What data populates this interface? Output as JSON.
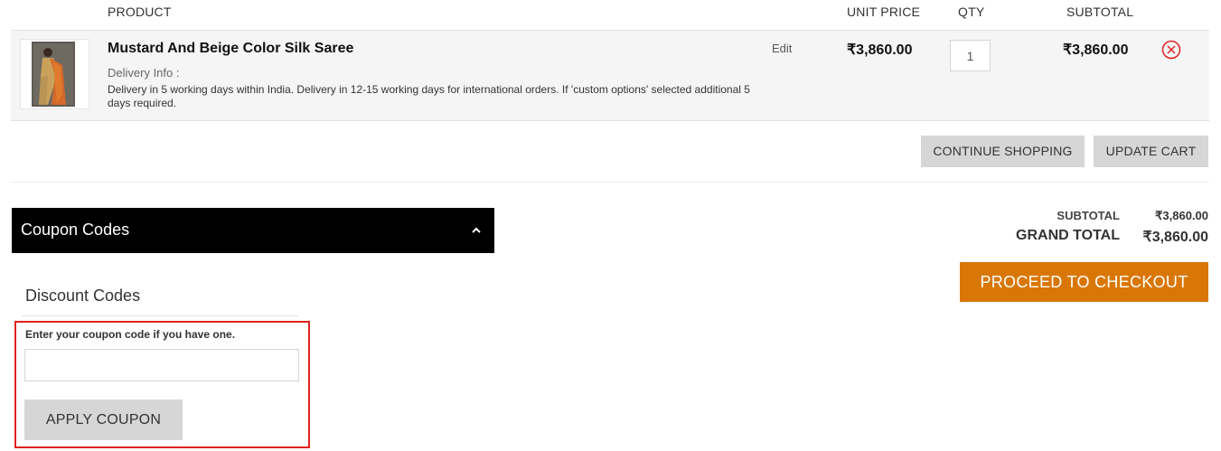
{
  "table_header": {
    "product": "PRODUCT",
    "unit_price": "UNIT PRICE",
    "qty": "QTY",
    "subtotal": "SUBTOTAL"
  },
  "item": {
    "name": "Mustard And Beige Color Silk Saree",
    "delivery_label": "Delivery Info :",
    "delivery_text": "Delivery in 5 working days within India. Delivery in 12-15 working days for international orders. If 'custom options' selected additional 5 days required.",
    "edit_label": "Edit",
    "unit_price": "₹3,860.00",
    "qty": "1",
    "subtotal": "₹3,860.00",
    "remove_icon": "close-circle-icon",
    "remove_color": "#e02020"
  },
  "actions": {
    "continue_shopping": "CONTINUE SHOPPING",
    "update_cart": "UPDATE CART"
  },
  "coupon": {
    "panel_title": "Coupon Codes",
    "discount_title": "Discount Codes",
    "hint": "Enter your coupon code if you have one.",
    "input_value": "",
    "apply_label": "APPLY COUPON",
    "highlight_color": "#e02020"
  },
  "totals": {
    "subtotal_label": "SUBTOTAL",
    "subtotal_value": "₹3,860.00",
    "grand_total_label": "GRAND TOTAL",
    "grand_total_value": "₹3,860.00",
    "checkout_label": "PROCEED TO CHECKOUT",
    "checkout_color": "#d97706"
  }
}
